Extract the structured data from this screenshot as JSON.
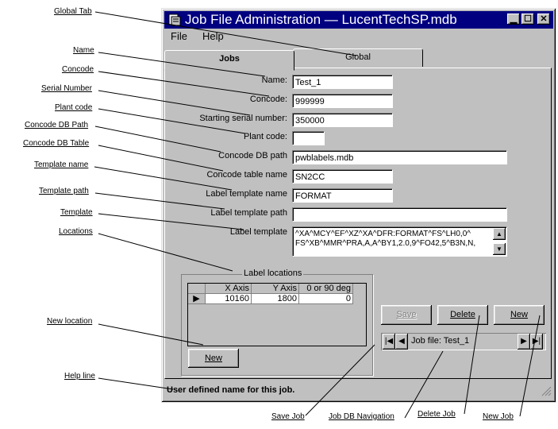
{
  "window": {
    "title": "Job File Administration — LucentTechSP.mdb",
    "controls": [
      "minimize",
      "maximize",
      "close"
    ]
  },
  "menu": {
    "file": "File",
    "help": "Help"
  },
  "tabs": {
    "jobs": "Jobs",
    "global": "Global"
  },
  "form": {
    "name_label": "Name:",
    "name_value": "Test_1",
    "concode_label": "Concode:",
    "concode_value": "999999",
    "serial_label": "Starting serial number:",
    "serial_value": "350000",
    "plant_label": "Plant code:",
    "plant_value": "",
    "dbpath_label": "Concode DB path",
    "dbpath_value": "pwblabels.mdb",
    "table_label": "Concode table name",
    "table_value": "SN2CC",
    "tplname_label": "Label template name",
    "tplname_value": "FORMAT",
    "tplpath_label": "Label template path",
    "tplpath_value": "",
    "template_label": "Label template",
    "template_line1": "^XA^MCY^EF^XZ^XA^DFR:FORMAT^FS^LH0,0^",
    "template_line2": "FS^XB^MMR^PRA,A,A^BY1,2.0,9^FO42,5^B3N,N,"
  },
  "locations": {
    "group_title": "Label locations",
    "columns": [
      "X Axis",
      "Y Axis",
      "0 or 90 deg"
    ],
    "rows": [
      {
        "x": "10160",
        "y": "1800",
        "deg": "0"
      }
    ],
    "new_button": "New"
  },
  "buttons": {
    "save": "Save",
    "delete": "Delete",
    "new": "New"
  },
  "navigation": {
    "label": "Job file: Test_1"
  },
  "status_text": "User defined name for this job.",
  "callouts": {
    "global_tab": "Global Tab",
    "name": "Name",
    "concode": "Concode",
    "serial_number": "Serial Number",
    "plant_code": "Plant code",
    "concode_db_path": "Concode DB Path",
    "concode_db_table": "Concode DB Table",
    "template_name": "Template name",
    "template_path": "Template path",
    "template": "Template",
    "locations": "Locations",
    "new_location": "New location",
    "help_line": "Help line",
    "save_job": "Save Job",
    "job_db_navigation": "Job DB Navigation",
    "delete_job": "Delete Job",
    "new_job": "New Job"
  },
  "colors": {
    "title_bar": "#000080",
    "face": "#c0c0c0"
  }
}
